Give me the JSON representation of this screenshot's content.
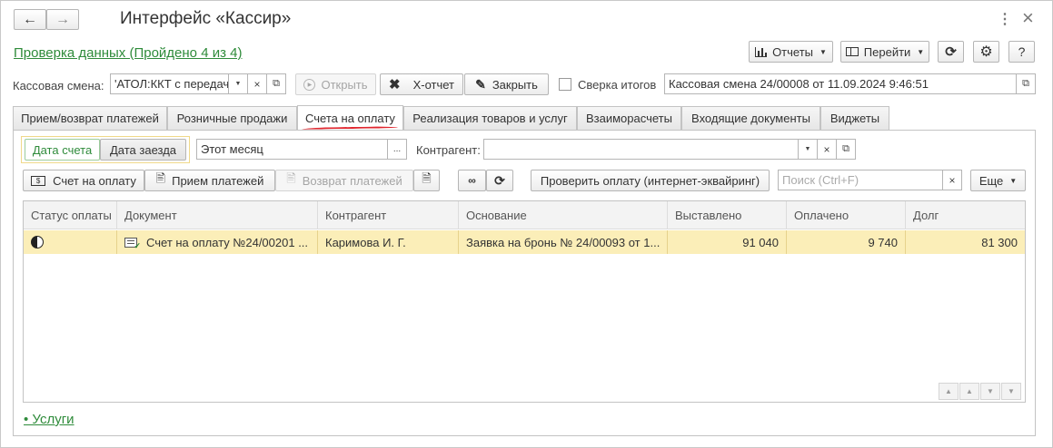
{
  "window": {
    "title": "Интерфейс «Кассир»",
    "check_link": "Проверка данных (Пройдено 4 из 4)",
    "more_glyph": "⋮",
    "close_glyph": "×"
  },
  "toolbar": {
    "reports": "Отчеты",
    "goto": "Перейти",
    "help": "?"
  },
  "shift_row": {
    "label": "Кассовая смена:",
    "value": "'АТОЛ:ККТ с передач",
    "open": "Открыть",
    "x_report": "Х-отчет",
    "close": "Закрыть",
    "reconcile_label": "Сверка итогов",
    "shift_info": "Кассовая смена 24/00008 от 11.09.2024 9:46:51"
  },
  "tabs": [
    {
      "label": "Прием/возврат платежей",
      "active": false
    },
    {
      "label": "Розничные продажи",
      "active": false
    },
    {
      "label": "Счета на оплату",
      "active": true
    },
    {
      "label": "Реализация товаров и услуг",
      "active": false
    },
    {
      "label": "Взаиморасчеты",
      "active": false
    },
    {
      "label": "Входящие документы",
      "active": false
    },
    {
      "label": "Виджеты",
      "active": false
    }
  ],
  "filters": {
    "date_invoice": "Дата счета",
    "date_arrival": "Дата заезда",
    "period": "Этот месяц",
    "dots": "...",
    "counterparty_label": "Контрагент:",
    "counterparty_value": ""
  },
  "actions": {
    "invoice": "Счет на оплату",
    "receive": "Прием платежей",
    "refund": "Возврат платежей",
    "check_payment": "Проверить оплату (интернет-эквайринг)",
    "search_placeholder": "Поиск (Ctrl+F)",
    "more": "Еще"
  },
  "table": {
    "columns": [
      "Статус оплаты",
      "Документ",
      "Контрагент",
      "Основание",
      "Выставлено",
      "Оплачено",
      "Долг"
    ],
    "rows": [
      {
        "status": "half-paid",
        "document": "Счет на оплату №24/00201 ...",
        "counterparty": "Каримова И. Г.",
        "basis": "Заявка на бронь № 24/00093 от 1...",
        "issued": "91 040",
        "paid": "9 740",
        "debt": "81 300"
      }
    ]
  },
  "footer": {
    "services_link": "• Услуги"
  },
  "colors": {
    "accent_green": "#2e8b3a",
    "row_highlight": "#fbeeb8",
    "active_tab_underline": "#e0262e"
  }
}
